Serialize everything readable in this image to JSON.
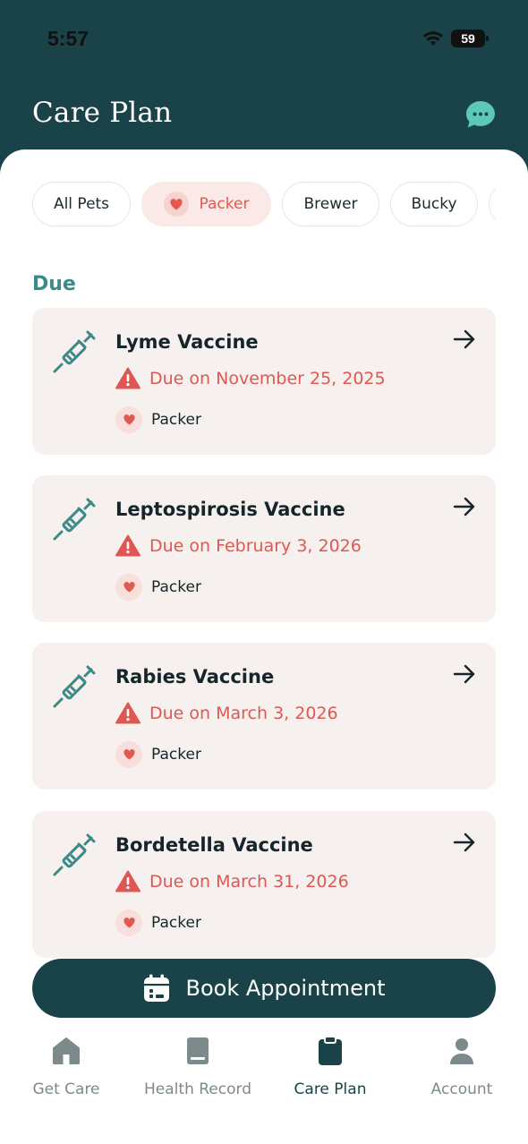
{
  "status_bar": {
    "time": "5:57",
    "battery": "59"
  },
  "header": {
    "title": "Care Plan",
    "chat_icon": "chat-bubble-icon",
    "accent": "#5cc8b8"
  },
  "filters": [
    {
      "label": "All Pets",
      "active": false
    },
    {
      "label": "Packer",
      "active": true
    },
    {
      "label": "Brewer",
      "active": false
    },
    {
      "label": "Bucky",
      "active": false
    }
  ],
  "section": {
    "due_label": "Due"
  },
  "items": [
    {
      "title": "Lyme Vaccine",
      "due": "Due on November 25, 2025",
      "pet": "Packer"
    },
    {
      "title": "Leptospirosis Vaccine",
      "due": "Due on February 3, 2026",
      "pet": "Packer"
    },
    {
      "title": "Rabies Vaccine",
      "due": "Due on March 3, 2026",
      "pet": "Packer"
    },
    {
      "title": "Bordetella Vaccine",
      "due": "Due on March 31, 2026",
      "pet": "Packer"
    }
  ],
  "cta": {
    "label": "Book Appointment",
    "icon": "calendar-icon"
  },
  "tabbar": [
    {
      "label": "Get Care",
      "icon": "house-icon",
      "active": false
    },
    {
      "label": "Health Record",
      "icon": "book-icon",
      "active": false
    },
    {
      "label": "Care Plan",
      "icon": "clipboard-icon",
      "active": true
    },
    {
      "label": "Account",
      "icon": "person-icon",
      "active": false
    }
  ],
  "colors": {
    "primary": "#1a4349",
    "teal": "#3c8a87",
    "alert": "#df5752",
    "card_bg": "#f6f1ee"
  }
}
